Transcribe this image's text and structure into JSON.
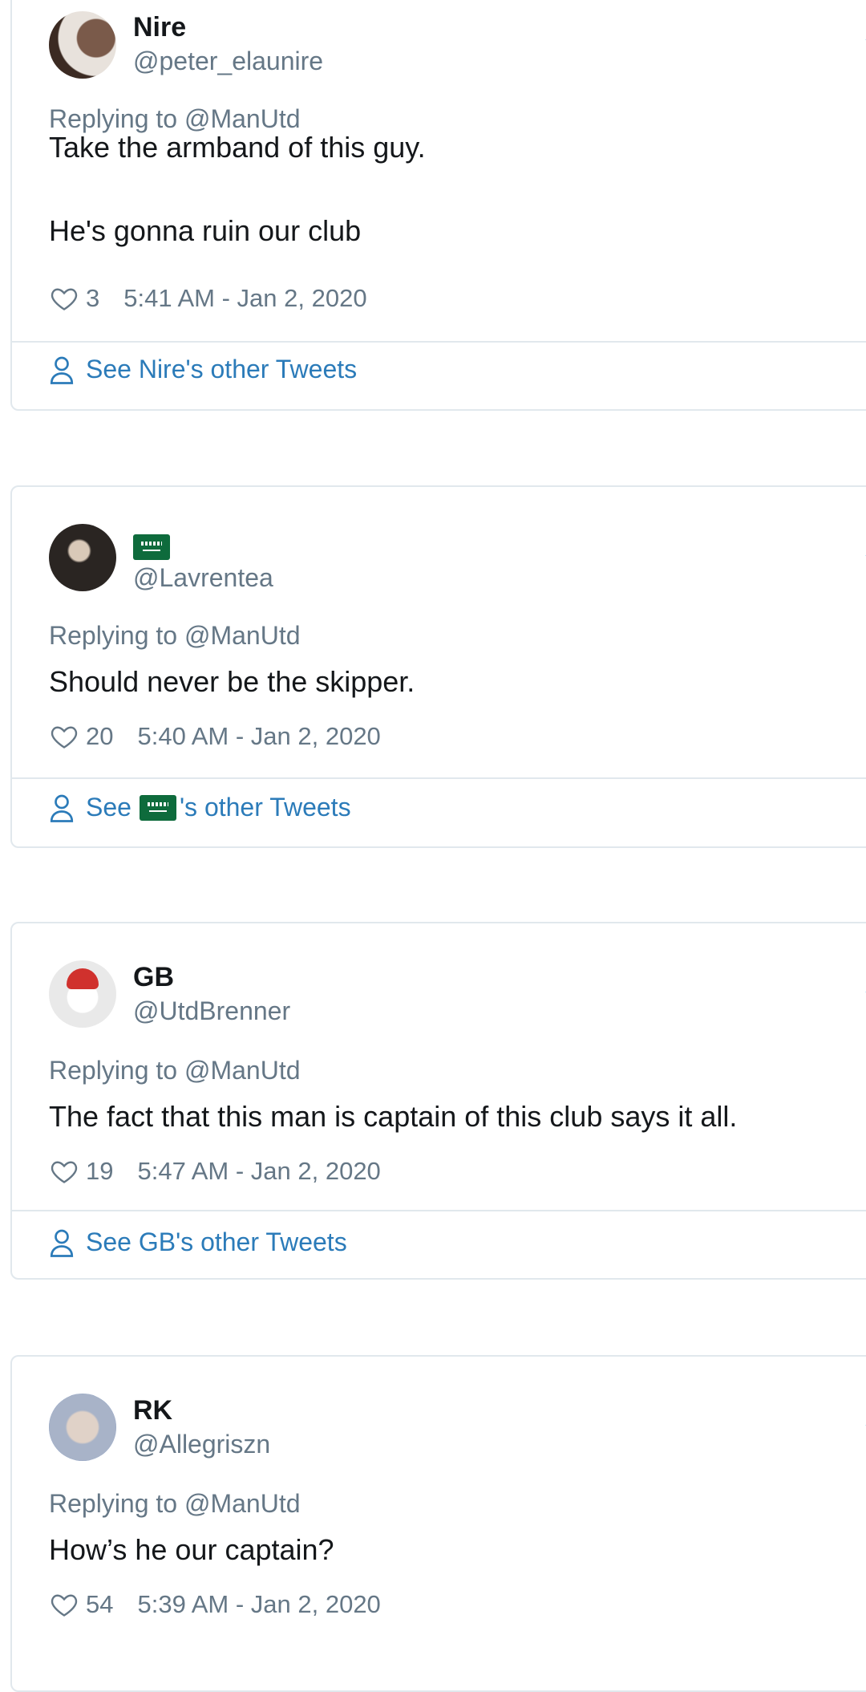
{
  "tweets": [
    {
      "name": "Nire",
      "handle": "@peter_elaunire",
      "replying_to": "Replying to @ManUtd",
      "text": "Take the armband of this guy.\n\nHe's gonna ruin our club",
      "likes": "3",
      "timestamp": "5:41 AM - Jan 2, 2020",
      "see_more": "See Nire's other Tweets"
    },
    {
      "name": "",
      "name_icon": "saudi-flag-emoji",
      "handle": "@Lavrentea",
      "replying_to": "Replying to @ManUtd",
      "text": "Should never be the skipper.",
      "likes": "20",
      "timestamp": "5:40 AM - Jan 2, 2020",
      "see_more_prefix": "See",
      "see_more_suffix": "'s other Tweets"
    },
    {
      "name": "GB",
      "handle": "@UtdBrenner",
      "replying_to": "Replying to @ManUtd",
      "text": "The fact that this man is captain of this club says it all.",
      "likes": "19",
      "timestamp": "5:47 AM - Jan 2, 2020",
      "see_more": "See GB's other Tweets"
    },
    {
      "name": "RK",
      "handle": "@Allegriszn",
      "replying_to": "Replying to @ManUtd",
      "text": "How’s he our captain?",
      "likes": "54",
      "timestamp": "5:39 AM - Jan 2, 2020"
    }
  ],
  "colors": {
    "link": "#2b7bb9",
    "secondary_text": "#657786",
    "border": "#e1e8ed",
    "twitter_blue": "#1da1f2"
  }
}
